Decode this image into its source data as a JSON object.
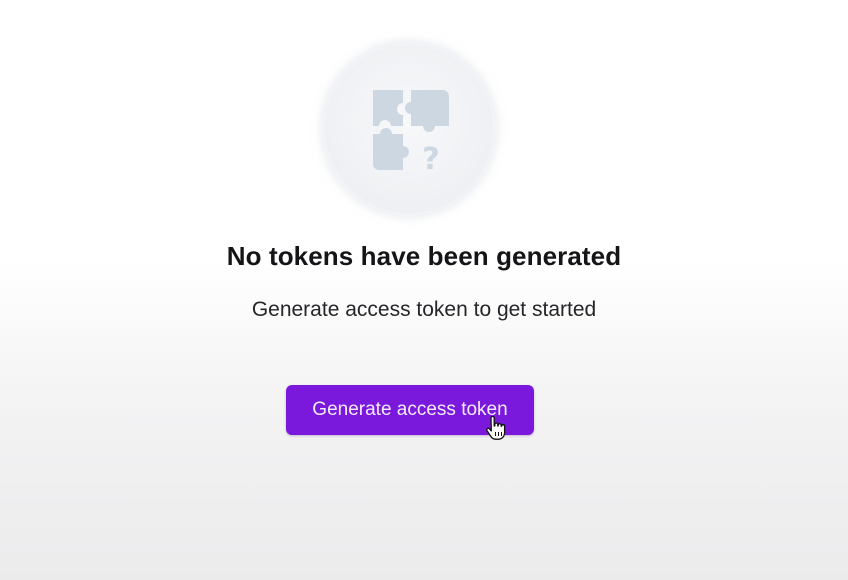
{
  "empty_state": {
    "illustration_icon": "puzzle-question-icon",
    "title": "No tokens have been generated",
    "subtitle": "Generate access token to get started",
    "cta_label": "Generate access token"
  },
  "colors": {
    "accent": "#7a18dc",
    "icon": "#c9d4e0"
  },
  "cursor_icon": "hand-pointer-icon"
}
